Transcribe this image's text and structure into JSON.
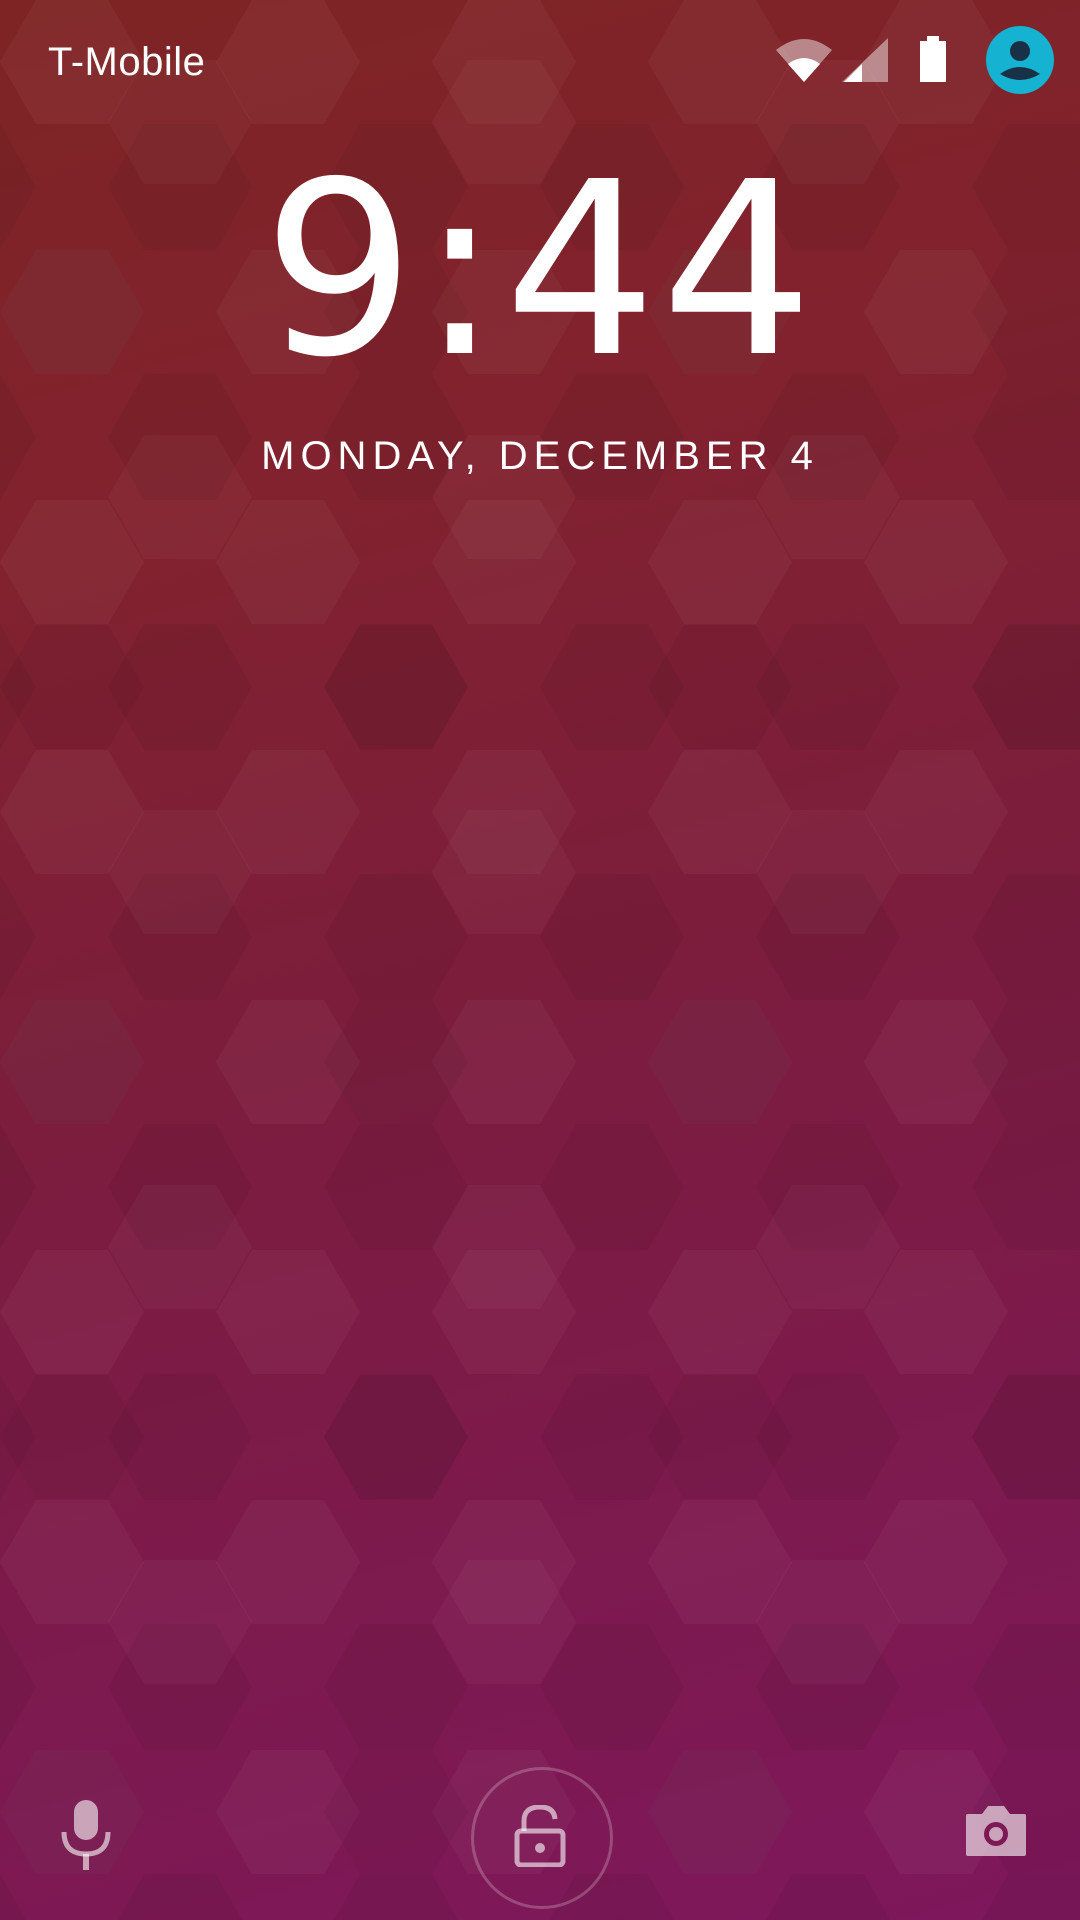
{
  "status_bar": {
    "carrier": "T-Mobile",
    "icons": [
      "wifi-icon",
      "cellular-signal-icon",
      "battery-icon",
      "user-avatar-icon"
    ],
    "avatar_color": "#15b3d1"
  },
  "lockscreen": {
    "time": "9:44",
    "date": "MONDAY, DECEMBER 4"
  },
  "bottom_actions": {
    "left": "microphone-icon",
    "center": "unlock-icon",
    "right": "camera-icon"
  },
  "colors": {
    "gradient_top": "#7e2424",
    "gradient_bottom": "#7e175c",
    "text": "#ffffff"
  }
}
